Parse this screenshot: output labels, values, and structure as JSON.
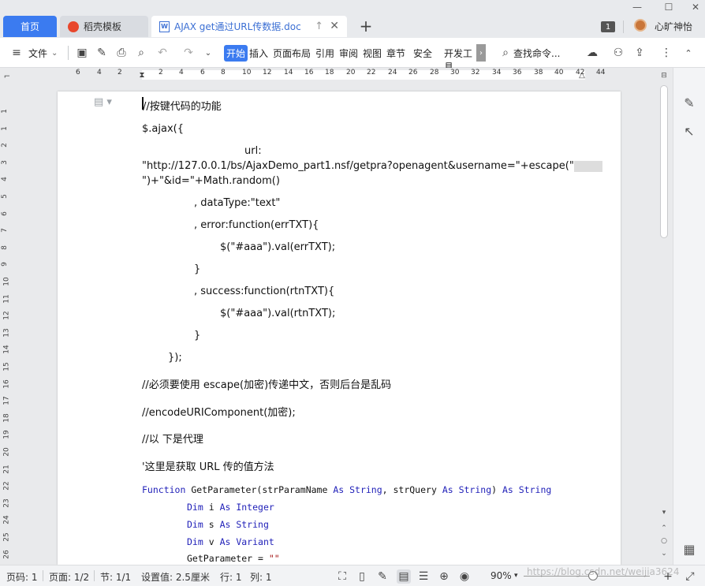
{
  "tabs": {
    "home": "首页",
    "daoke": "稻壳模板",
    "doc": "AJAX get通过URL传数据.doc"
  },
  "window": {
    "badge": "1",
    "username": "心旷神怡"
  },
  "toolbar": {
    "file": "文件",
    "items": [
      "开始",
      "插入",
      "页面布局",
      "引用",
      "审阅",
      "视图",
      "章节",
      "安全",
      "开发工具"
    ],
    "search": "查找命令..."
  },
  "ruler": {
    "marks": [
      "6",
      "4",
      "2",
      "2",
      "4",
      "6",
      "8",
      "10",
      "12",
      "14",
      "16",
      "18",
      "20",
      "22",
      "24",
      "26",
      "28",
      "30",
      "32",
      "34",
      "36",
      "38",
      "40",
      "42",
      "44"
    ],
    "vmarks": [
      "1",
      "1",
      "2",
      "3",
      "4",
      "5",
      "6",
      "7",
      "8",
      "9",
      "10",
      "11",
      "12",
      "13",
      "14",
      "15",
      "16",
      "17",
      "18",
      "19",
      "20",
      "21",
      "22",
      "23",
      "24",
      "25",
      "26",
      "27"
    ]
  },
  "document": {
    "l1": "//按键代码的功能",
    "l2": "$.ajax({",
    "l3": "url:",
    "l4": "\"http://127.0.0.1/bs/AjaxDemo_part1.nsf/getpra?openagent&username=\"+escape(\"",
    "l5": "\")+\"&id=\"+Math.random()",
    "l6": ", dataType:\"text\"",
    "l7": ", error:function(errTXT){",
    "l8": "$(\"#aaa\").val(errTXT);",
    "l9": "}",
    "l10": ", success:function(rtnTXT){",
    "l11": "$(\"#aaa\").val(rtnTXT);",
    "l12": "}",
    "l13": "});",
    "l14": "//必须要使用 escape(加密)传递中文，否则后台是乱码",
    "l15": "//encodeURIComponent(加密);",
    "l16": "//以 下是代理",
    "l17": "'这里是获取 URL 传的值方法",
    "c1_kw1": "Function",
    "c1_rest": " GetParameter(strParamName ",
    "c1_kw2": "As String",
    "c1_mid": ", strQuery ",
    "c1_kw3": "As String",
    "c1_end": ") ",
    "c1_kw4": "As String",
    "c2_kw": "Dim",
    "c2_var": " i ",
    "c2_type": "As Integer",
    "c3_kw": "Dim",
    "c3_var": " s ",
    "c3_type": "As String",
    "c4_kw": "Dim",
    "c4_var": " v ",
    "c4_type": "As Variant",
    "c5_text": "GetParameter = ",
    "c5_str": "\"\""
  },
  "status": {
    "page": "页码: 1",
    "pages": "页面: 1/2",
    "section": "节: 1/1",
    "setting": "设置值: 2.5厘米",
    "row": "行: 1",
    "col": "列: 1",
    "zoom": "90%",
    "watermark": "https://blog.csdn.net/weijia3624"
  }
}
